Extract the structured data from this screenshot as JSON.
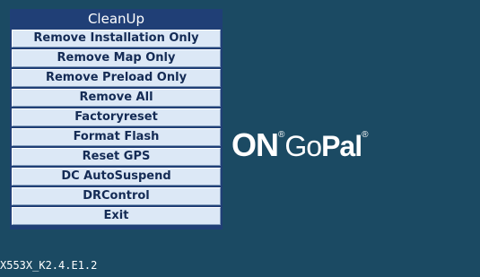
{
  "menu": {
    "title": "CleanUp",
    "items": [
      {
        "label": "Remove Installation Only"
      },
      {
        "label": "Remove Map Only"
      },
      {
        "label": "Remove Preload Only"
      },
      {
        "label": "Remove All"
      },
      {
        "label": "Factoryreset"
      },
      {
        "label": "Format Flash"
      },
      {
        "label": "Reset GPS"
      },
      {
        "label": "DC AutoSuspend"
      },
      {
        "label": "DRControl"
      },
      {
        "label": "Exit"
      }
    ]
  },
  "logo": {
    "part1": "ON",
    "part2": "Go",
    "part3": "Pal",
    "registered": "®"
  },
  "footer": {
    "version": "X553X_K2.4.E1.2"
  },
  "colors": {
    "background": "#1b4a63",
    "menu_frame": "#203f76",
    "button_face": "#dce8f6",
    "button_text": "#142b55"
  }
}
